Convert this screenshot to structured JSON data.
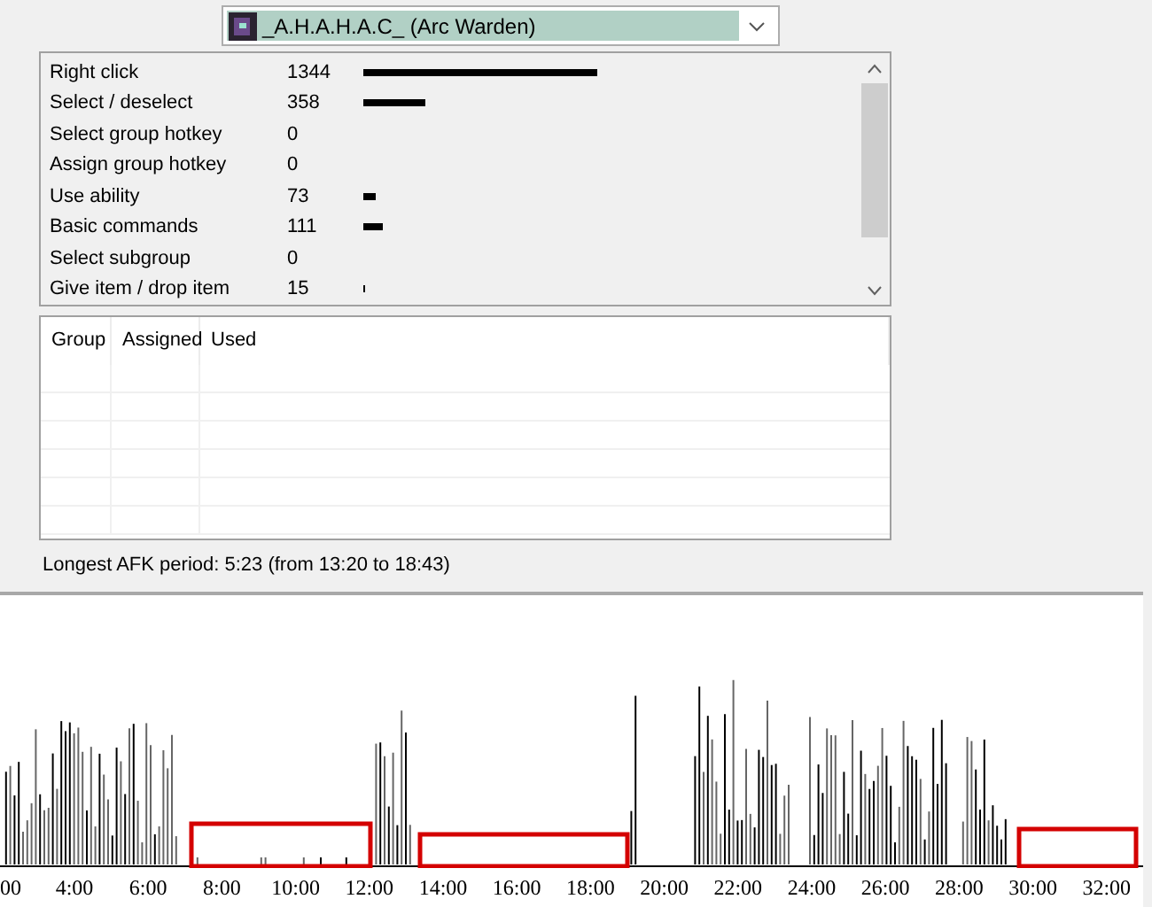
{
  "player_select": {
    "value": "_A.H.A.H.A.C_ (Arc Warden)"
  },
  "actions": [
    {
      "name": "Right click",
      "count": "1344"
    },
    {
      "name": "Select / deselect",
      "count": "358"
    },
    {
      "name": "Select group hotkey",
      "count": "0"
    },
    {
      "name": "Assign group hotkey",
      "count": "0"
    },
    {
      "name": "Use ability",
      "count": "73"
    },
    {
      "name": "Basic commands",
      "count": "111"
    },
    {
      "name": "Select subgroup",
      "count": "0"
    },
    {
      "name": "Give item / drop item",
      "count": "15"
    }
  ],
  "groups_table": {
    "columns": [
      "Group",
      "Assigned",
      "Used"
    ]
  },
  "afk_summary": "Longest AFK period: 5:23 (from 13:20 to 18:43)",
  "activity_chart": {
    "time_labels": [
      "00",
      "4:00",
      "6:00",
      "8:00",
      "10:00",
      "12:00",
      "14:00",
      "16:00",
      "18:00",
      "20:00",
      "22:00",
      "24:00",
      "26:00",
      "28:00",
      "30:00",
      "32:00"
    ]
  }
}
